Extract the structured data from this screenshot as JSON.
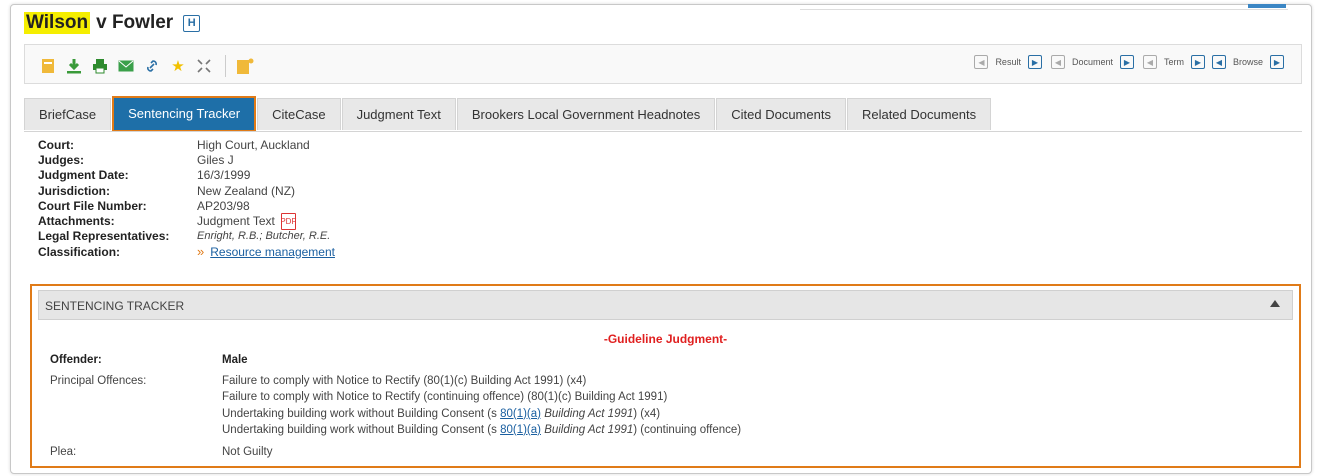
{
  "header": {
    "title_highlight": "Wilson",
    "title_rest": "v  Fowler",
    "badge": "H"
  },
  "toolbar": {
    "icons": [
      "document-icon",
      "download-icon",
      "print-icon",
      "email-icon",
      "link-icon",
      "star-icon",
      "expand-icon",
      "new-note-icon"
    ],
    "nav": {
      "result": "Result",
      "document": "Document",
      "term": "Term",
      "browse": "Browse"
    }
  },
  "tabs": [
    {
      "label": "BriefCase",
      "active": false
    },
    {
      "label": "Sentencing Tracker",
      "active": true
    },
    {
      "label": "CiteCase",
      "active": false
    },
    {
      "label": "Judgment Text",
      "active": false
    },
    {
      "label": "Brookers Local Government Headnotes",
      "active": false
    },
    {
      "label": "Cited Documents",
      "active": false
    },
    {
      "label": "Related Documents",
      "active": false
    }
  ],
  "meta": {
    "court": {
      "label": "Court:",
      "value": "High Court, Auckland"
    },
    "judges": {
      "label": "Judges:",
      "value": "Giles J"
    },
    "date": {
      "label": "Judgment Date:",
      "value": "16/3/1999"
    },
    "jurisdiction": {
      "label": "Jurisdiction:",
      "value": "New Zealand (NZ)"
    },
    "file": {
      "label": "Court File Number:",
      "value": "AP203/98"
    },
    "attachments": {
      "label": "Attachments:",
      "value": "Judgment Text"
    },
    "reps": {
      "label": "Legal Representatives:",
      "value": "Enright, R.B.; Butcher, R.E."
    },
    "classification": {
      "label": "Classification:",
      "marker": "»",
      "value": "Resource management"
    }
  },
  "sentencing": {
    "header": "SENTENCING TRACKER",
    "guideline": "-Guideline Judgment-",
    "offender_label": "Offender:",
    "offender_value": "Male",
    "offences_label": "Principal Offences:",
    "offences": {
      "o1": "Failure to comply with Notice to Rectify (80(1)(c) Building Act 1991) (x4)",
      "o2": "Failure to comply with Notice to Rectify (continuing offence) (80(1)(c) Building Act 1991)",
      "o3_pre": "Undertaking building work without Building Consent (s ",
      "o3_link": "80(1)(a)",
      "o3_act": "Building Act 1991",
      "o3_post": ") (x4)",
      "o4_pre": "Undertaking building work without Building Consent (s ",
      "o4_link": "80(1)(a)",
      "o4_act": "Building Act 1991",
      "o4_post": ") (continuing offence)"
    },
    "plea_label": "Plea:",
    "plea_value": "Not Guilty"
  },
  "colors": {
    "accent_tab": "#1e6fa8",
    "highlight_border": "#e07b18",
    "guideline_red": "#e02020"
  }
}
